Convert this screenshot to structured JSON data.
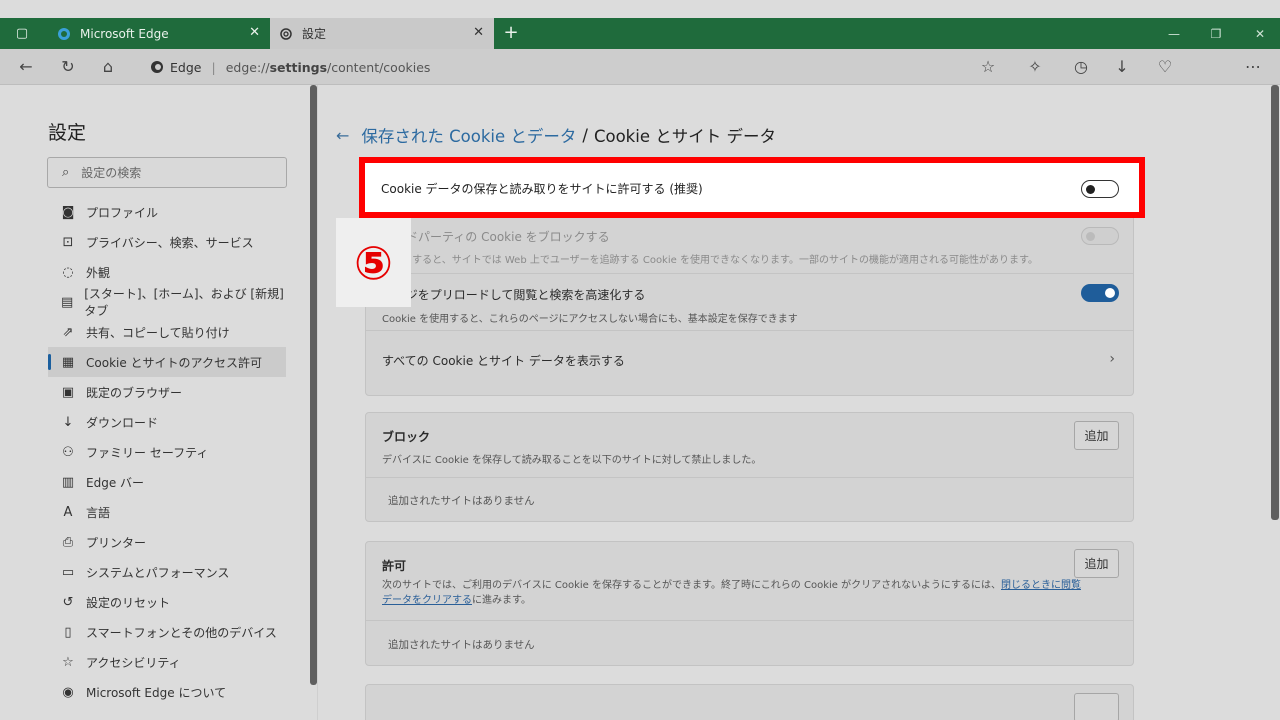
{
  "browser": {
    "tabs": [
      {
        "title": "Microsoft Edge",
        "active": false
      },
      {
        "title": "設定",
        "active": true
      }
    ],
    "address": {
      "site_label": "Edge",
      "url_base": "edge://",
      "url_path": "settings",
      "url_rest": "/content/cookies"
    }
  },
  "sidebar": {
    "title": "設定",
    "search_placeholder": "設定の検索",
    "items": [
      {
        "label": "プロファイル",
        "icon": "profile-icon"
      },
      {
        "label": "プライバシー、検索、サービス",
        "icon": "lock-icon"
      },
      {
        "label": "外観",
        "icon": "appearance-icon"
      },
      {
        "label": "[スタート]、[ホーム]、および [新規] タブ",
        "icon": "home-tab-icon"
      },
      {
        "label": "共有、コピーして貼り付け",
        "icon": "share-icon"
      },
      {
        "label": "Cookie とサイトのアクセス許可",
        "icon": "site-permissions-icon",
        "active": true
      },
      {
        "label": "既定のブラウザー",
        "icon": "browser-icon"
      },
      {
        "label": "ダウンロード",
        "icon": "download-icon"
      },
      {
        "label": "ファミリー セーフティ",
        "icon": "family-icon"
      },
      {
        "label": "Edge バー",
        "icon": "edge-bar-icon"
      },
      {
        "label": "言語",
        "icon": "language-icon"
      },
      {
        "label": "プリンター",
        "icon": "printer-icon"
      },
      {
        "label": "システムとパフォーマンス",
        "icon": "system-icon"
      },
      {
        "label": "設定のリセット",
        "icon": "reset-icon"
      },
      {
        "label": "スマートフォンとその他のデバイス",
        "icon": "phone-icon"
      },
      {
        "label": "アクセシビリティ",
        "icon": "accessibility-icon"
      },
      {
        "label": "Microsoft Edge について",
        "icon": "edge-logo-icon"
      }
    ]
  },
  "main": {
    "breadcrumb_parent": "保存された Cookie とデータ",
    "breadcrumb_sep": "/",
    "breadcrumb_current": "Cookie とサイト データ",
    "highlight_setting": "Cookie データの保存と読み取りをサイトに許可する (推奨)",
    "step_number": "⑤",
    "settings": [
      {
        "title": "サードパーティの Cookie をブロックする",
        "desc": "有効にすると、サイトでは Web 上でユーザーを追跡する Cookie を使用できなくなります。一部のサイトの機能が適用される可能性があります。"
      },
      {
        "title": "ページをプリロードして閲覧と検索を高速化する",
        "desc": "Cookie を使用すると、これらのページにアクセスしない場合にも、基本設定を保存できます",
        "toggle": "on"
      },
      {
        "title": "すべての Cookie とサイト データを表示する"
      }
    ],
    "block": {
      "title": "ブロック",
      "desc": "デバイスに Cookie を保存して読み取ることを以下のサイトに対して禁止しました。",
      "add_label": "追加",
      "empty": "追加されたサイトはありません"
    },
    "allow": {
      "title": "許可",
      "desc_part1": "次のサイトでは、ご利用のデバイスに Cookie を保存することができます。終了時にこれらの Cookie がクリアされないようにするには、",
      "desc_link": "閉じるときに閲覧データをクリアする",
      "desc_part2": "に進みます。",
      "add_label": "追加",
      "empty": "追加されたサイトはありません"
    }
  },
  "colors": {
    "tab_strip": "#1f6b3c",
    "accent": "#1f5d9a",
    "highlight_border": "#ff0000",
    "step_number": "#e60000"
  }
}
